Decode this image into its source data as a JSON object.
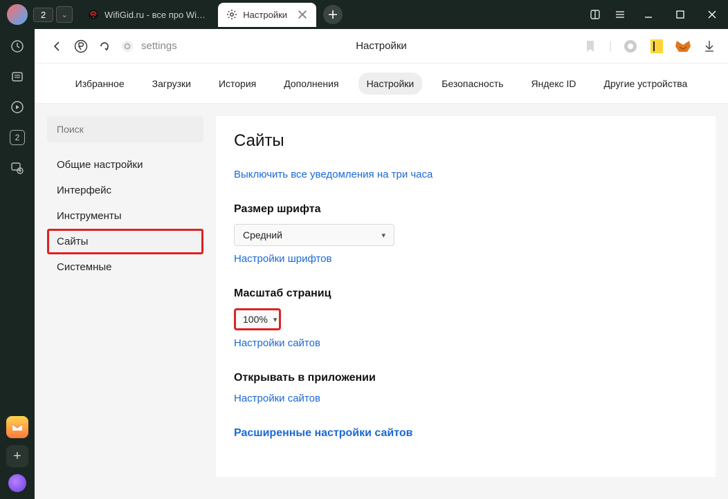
{
  "window": {
    "tab_badge_count": "2",
    "controls": {
      "extra1_icon": "panel-icon",
      "extra2_icon": "menu-icon"
    }
  },
  "tabs": [
    {
      "title": "WifiGid.ru - все про WiFi и",
      "icon": "wifi-icon",
      "active": false
    },
    {
      "title": "Настройки",
      "icon": "gear-icon",
      "active": true
    }
  ],
  "address": {
    "text": "settings",
    "page_title": "Настройки"
  },
  "leftbar": {
    "count": "2"
  },
  "topnav": {
    "items": [
      "Избранное",
      "Загрузки",
      "История",
      "Дополнения",
      "Настройки",
      "Безопасность",
      "Яндекс ID",
      "Другие устройства"
    ],
    "active_index": 4
  },
  "sidebar": {
    "search_placeholder": "Поиск",
    "items": [
      "Общие настройки",
      "Интерфейс",
      "Инструменты",
      "Сайты",
      "Системные"
    ],
    "selected_index": 3
  },
  "page": {
    "heading": "Сайты",
    "notifications_link": "Выключить все уведомления на три часа",
    "font_size": {
      "label": "Размер шрифта",
      "value": "Средний",
      "settings_link": "Настройки шрифтов"
    },
    "zoom": {
      "label": "Масштаб страниц",
      "value": "100%",
      "settings_link": "Настройки сайтов"
    },
    "open_in_app": {
      "label": "Открывать в приложении",
      "settings_link": "Настройки сайтов"
    },
    "advanced_link": "Расширенные настройки сайтов"
  }
}
